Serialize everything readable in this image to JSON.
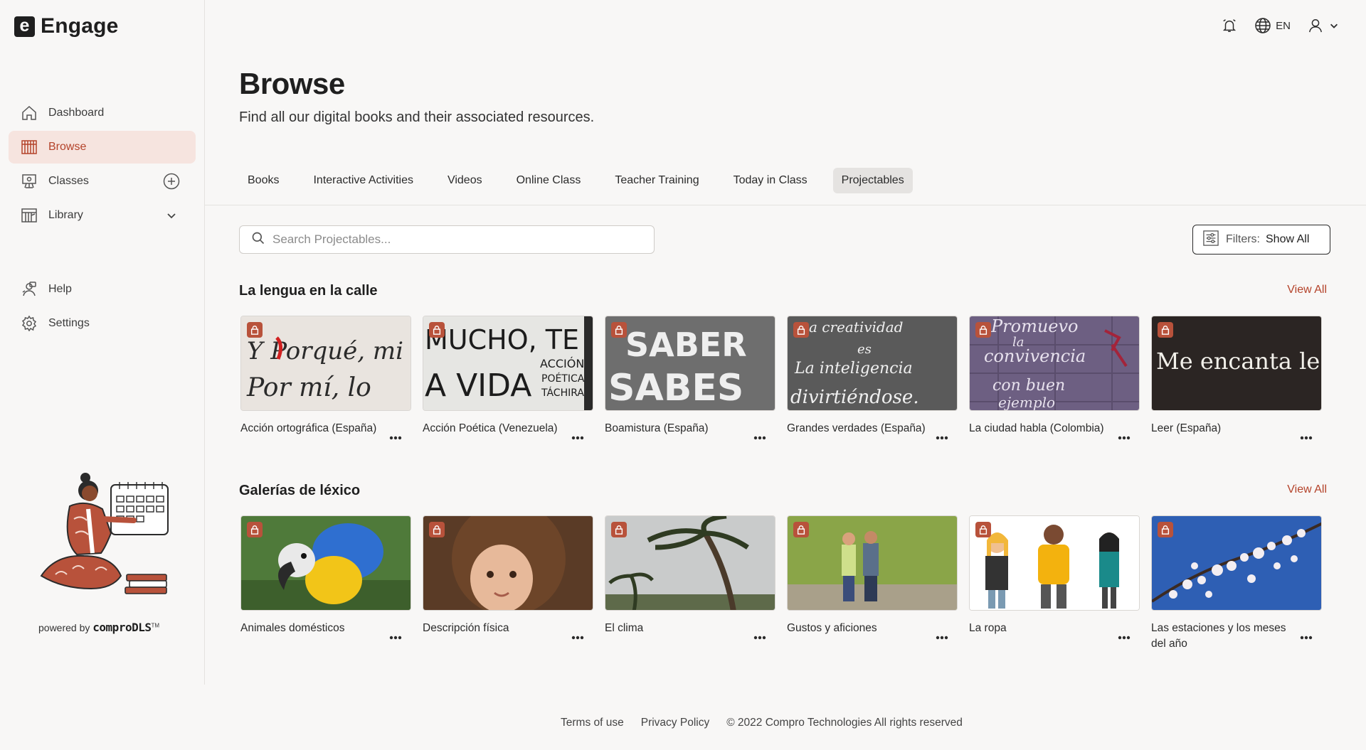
{
  "app": {
    "logo_letter": "e",
    "name": "Engage"
  },
  "nav": {
    "items": [
      {
        "label": "Dashboard",
        "icon": "home-icon"
      },
      {
        "label": "Browse",
        "icon": "books-icon",
        "active": true
      },
      {
        "label": "Classes",
        "icon": "classes-icon",
        "trail": "add-circle-icon"
      },
      {
        "label": "Library",
        "icon": "library-icon",
        "trail": "chevron-down-icon"
      }
    ],
    "secondary": [
      {
        "label": "Help",
        "icon": "help-icon"
      },
      {
        "label": "Settings",
        "icon": "gear-icon"
      }
    ]
  },
  "powered": {
    "prefix": "powered by",
    "brand": "comproDLS",
    "tm": "TM"
  },
  "topbar": {
    "language": "EN"
  },
  "page": {
    "title": "Browse",
    "subtitle": "Find all our digital books and their associated resources."
  },
  "tabs": [
    "Books",
    "Interactive Activities",
    "Videos",
    "Online Class",
    "Teacher Training",
    "Today in Class",
    "Projectables"
  ],
  "active_tab": "Projectables",
  "search": {
    "placeholder": "Search Projectables..."
  },
  "filters": {
    "label": "Filters:",
    "value": "Show All"
  },
  "sections": [
    {
      "title": "La lengua en la calle",
      "view_all": "View All",
      "cards": [
        {
          "title": "Acción ortográfica (España)",
          "thumb_text": "Y Porqué, mi Por mí, lo"
        },
        {
          "title": "Acción Poética (Venezuela)",
          "thumb_text": "MUCHO, TE A VIDA"
        },
        {
          "title": "Boamistura (España)",
          "thumb_text": "SABER SABES"
        },
        {
          "title": "Grandes verdades (España)",
          "thumb_text": "la creatividad es la inteligencia divirtiéndose."
        },
        {
          "title": "La ciudad habla (Colombia)",
          "thumb_text": "Promuevo la convivencia con buen ejemplo"
        },
        {
          "title": "Leer (España)",
          "thumb_text": "Me encanta leer."
        }
      ]
    },
    {
      "title": "Galerías de léxico",
      "view_all": "View All",
      "cards": [
        {
          "title": "Animales domésticos"
        },
        {
          "title": "Descripción física"
        },
        {
          "title": "El clima"
        },
        {
          "title": "Gustos y aficiones"
        },
        {
          "title": "La ropa"
        },
        {
          "title": "Las estaciones y los meses del año"
        }
      ]
    }
  ],
  "footer": {
    "terms": "Terms of use",
    "privacy": "Privacy Policy",
    "copyright": "© 2022 Compro Technologies All rights reserved"
  },
  "colors": {
    "accent": "#b4432a",
    "active_bg": "#f6e4df",
    "lock": "#b8523b"
  }
}
